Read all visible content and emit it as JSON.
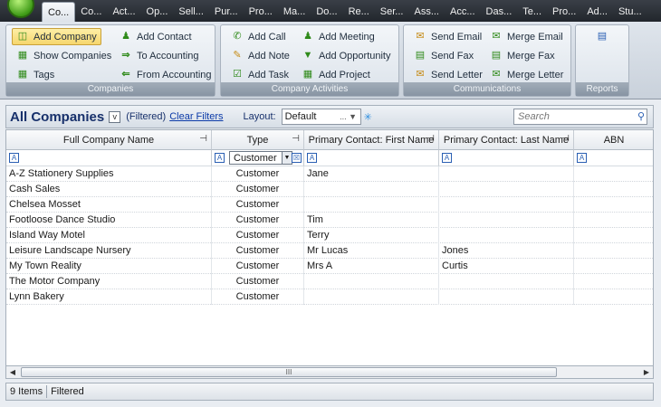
{
  "tabs": [
    "Co...",
    "Co...",
    "Act...",
    "Op...",
    "Sell...",
    "Pur...",
    "Pro...",
    "Ma...",
    "Do...",
    "Re...",
    "Ser...",
    "Ass...",
    "Acc...",
    "Das...",
    "Te...",
    "Pro...",
    "Ad...",
    "Stu..."
  ],
  "ribbon": {
    "companies": {
      "label": "Companies",
      "buttons": [
        "Add Company",
        "Add Contact",
        "Show Companies",
        "To Accounting",
        "Tags",
        "From Accounting"
      ]
    },
    "activities": {
      "label": "Company Activities",
      "buttons": [
        "Add Call",
        "Add Meeting",
        "Add Note",
        "Add Opportunity",
        "Add Task",
        "Add Project"
      ]
    },
    "communications": {
      "label": "Communications",
      "buttons": [
        "Send Email",
        "Merge Email",
        "Send Fax",
        "Merge Fax",
        "Send Letter",
        "Merge Letter"
      ]
    },
    "reports": {
      "label": "Reports"
    }
  },
  "header": {
    "title": "All Companies",
    "v": "v",
    "filtered": "(Filtered)",
    "clear_filters": "Clear Filters",
    "layout_label": "Layout:",
    "layout_value": "Default",
    "layout_more": "...",
    "search_placeholder": "Search"
  },
  "grid": {
    "columns": [
      "Full Company Name",
      "Type",
      "Primary Contact: First Name",
      "Primary Contact: Last Name",
      "ABN"
    ],
    "type_filter": "Customer",
    "rows": [
      {
        "name": "A-Z Stationery Supplies",
        "type": "Customer",
        "first": "Jane",
        "last": ""
      },
      {
        "name": "Cash Sales",
        "type": "Customer",
        "first": "",
        "last": ""
      },
      {
        "name": "Chelsea Mosset",
        "type": "Customer",
        "first": "",
        "last": ""
      },
      {
        "name": "Footloose Dance Studio",
        "type": "Customer",
        "first": "Tim",
        "last": ""
      },
      {
        "name": "Island Way Motel",
        "type": "Customer",
        "first": "Terry",
        "last": ""
      },
      {
        "name": "Leisure Landscape Nursery",
        "type": "Customer",
        "first": "Mr Lucas",
        "last": "Jones"
      },
      {
        "name": "My Town Reality",
        "type": "Customer",
        "first": "Mrs A",
        "last": "Curtis"
      },
      {
        "name": "The Motor Company",
        "type": "Customer",
        "first": "",
        "last": ""
      },
      {
        "name": "Lynn Bakery",
        "type": "Customer",
        "first": "",
        "last": ""
      }
    ]
  },
  "scroll_grip": "III",
  "status": {
    "count": "9 Items",
    "state": "Filtered"
  }
}
